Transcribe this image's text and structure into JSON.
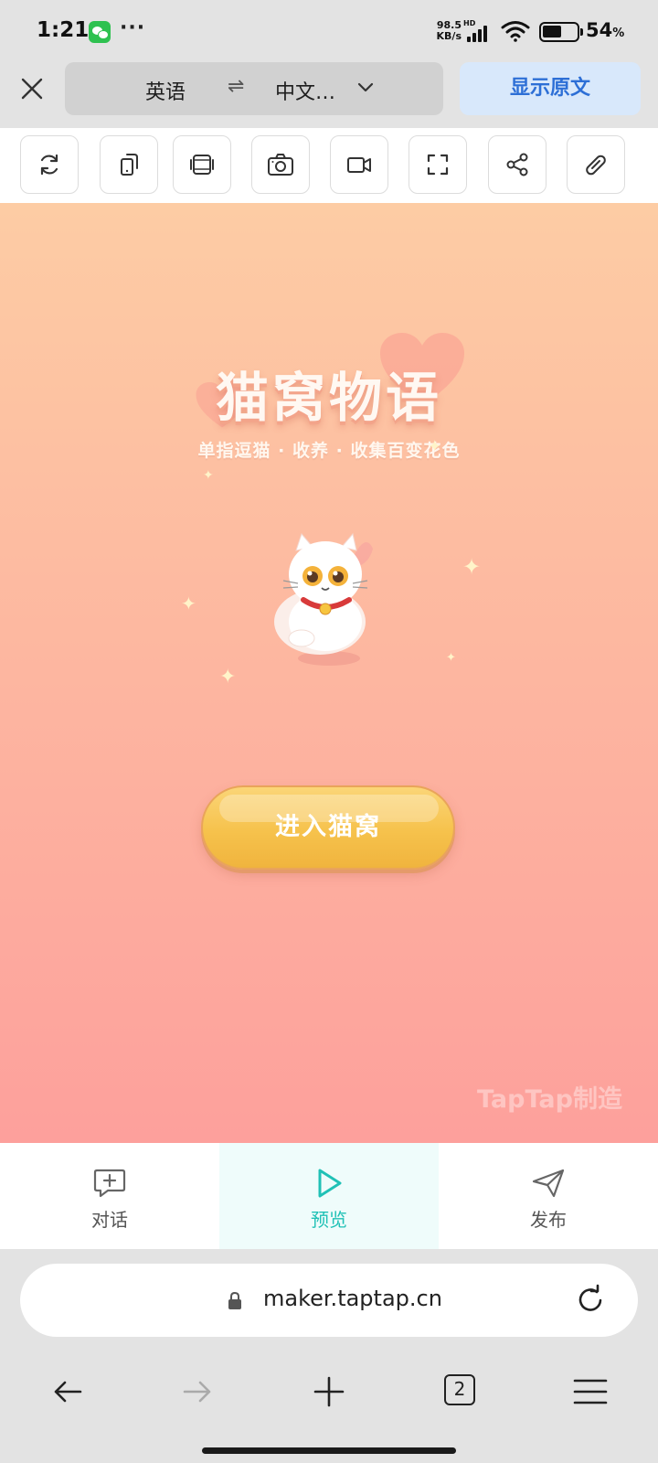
{
  "status_bar": {
    "time": "1:21",
    "menu_dots": "···",
    "net_speed_value": "98.5",
    "net_speed_unit": "KB/s",
    "hd_label": "HD",
    "battery_percent": "54",
    "battery_symbol": "%",
    "battery_level": 0.54
  },
  "translate_bar": {
    "source_language": "英语",
    "target_language": "中文…",
    "show_original": "显示原文"
  },
  "toolbar": {
    "buttons": [
      "refresh-icon",
      "rotate-phone-icon",
      "device-frame-icon",
      "screenshot-camera-icon",
      "record-video-icon",
      "fullscreen-icon",
      "share-icon",
      "link-icon"
    ]
  },
  "game": {
    "title": "猫窝物语",
    "subtitle": "单指逗猫 · 收养 · 收集百变花色",
    "enter_button": "进入猫窝",
    "watermark": "TapTap制造"
  },
  "app_nav": {
    "tabs": [
      {
        "label": "对话",
        "icon": "chat-plus-icon",
        "active": false
      },
      {
        "label": "预览",
        "icon": "play-icon",
        "active": true
      },
      {
        "label": "发布",
        "icon": "send-icon",
        "active": false
      }
    ],
    "active_color": "#20c1b6"
  },
  "address_bar": {
    "url": "maker.taptap.cn"
  },
  "browser_bar": {
    "tab_count": "2"
  },
  "colors": {
    "accent_blue": "#2d6fd6",
    "button_yellow": "#f6c24c",
    "bg_top": "#fdcca4",
    "bg_bottom": "#fda09c"
  }
}
